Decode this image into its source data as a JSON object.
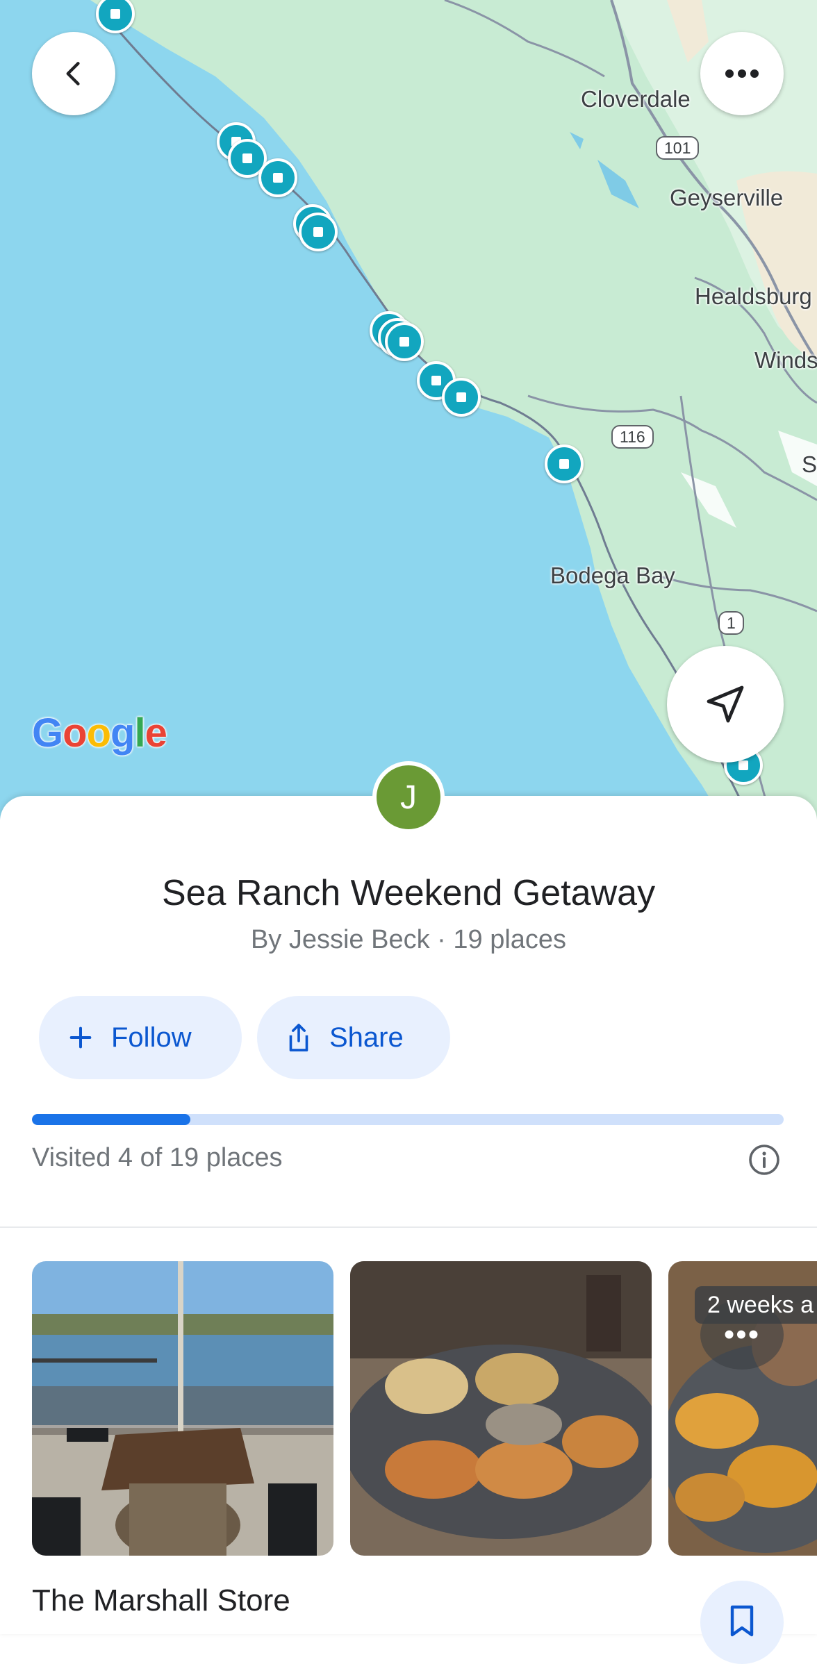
{
  "map": {
    "labels": {
      "cloverdale": "Cloverdale",
      "geyserville": "Geyserville",
      "healdsburg": "Healdsburg",
      "windsor": "Winds",
      "santa_rosa": "S",
      "bodega_bay": "Bodega Bay"
    },
    "shields": {
      "us101": "101",
      "hwy116": "116",
      "hwy1": "1"
    },
    "logo": {
      "g1": "G",
      "o1": "o",
      "o2": "o",
      "g2": "g",
      "l": "l",
      "e": "e"
    },
    "pin_color": "#12a6bf",
    "water_color": "#8dd6ee",
    "land_color": "#c8ebd3"
  },
  "list": {
    "avatar_letter": "J",
    "avatar_color": "#6a9a35",
    "title": "Sea Ranch Weekend Getaway",
    "subtitle": "By Jessie Beck · 19 places",
    "follow_label": "Follow",
    "share_label": "Share",
    "visited_text": "Visited 4 of 19 places",
    "visited_count": 4,
    "total_places": 19
  },
  "place": {
    "name": "The Marshall Store",
    "photo_badge": "2 weeks a",
    "more_label": "•••"
  },
  "accent": "#0b57d0"
}
